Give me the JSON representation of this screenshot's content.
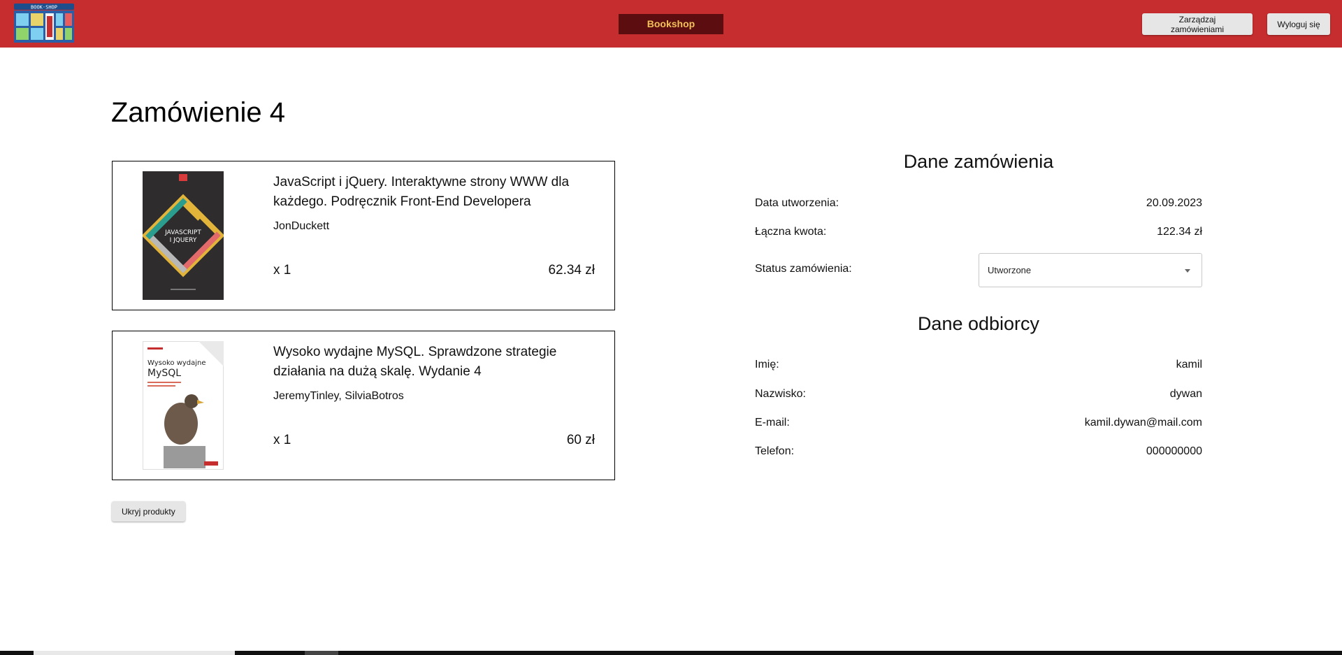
{
  "header": {
    "brand": "Bookshop",
    "logo_text": "BOOK·SHOP",
    "manage_orders_label": "Zarządzaj zamówieniami",
    "logout_label": "Wyloguj się"
  },
  "page": {
    "title": "Zamówienie 4"
  },
  "products": [
    {
      "title": "JavaScript i jQuery. Interaktywne strony WWW dla każdego. Podręcznik Front-End Developera",
      "author": "JonDuckett",
      "qty": "x 1",
      "price": "62.34 zł",
      "cover_lines": [
        "JAVASCRIPT",
        "I JQUERY"
      ]
    },
    {
      "title": "Wysoko wydajne MySQL. Sprawdzone strategie działania na dużą skalę. Wydanie 4",
      "author": "JeremyTinley, SilviaBotros",
      "qty": "x 1",
      "price": "60 zł",
      "cover_lines": [
        "Wysoko wydajne",
        "MySQL"
      ]
    }
  ],
  "hide_products_label": "Ukryj produkty",
  "order_details": {
    "title": "Dane zamówienia",
    "created_label": "Data utworzenia:",
    "created_value": "20.09.2023",
    "total_label": "Łączna kwota:",
    "total_value": "122.34 zł",
    "status_label": "Status zamówienia:",
    "status_value": "Utworzone"
  },
  "recipient": {
    "title": "Dane odbiorcy",
    "first_name_label": "Imię:",
    "first_name_value": "kamil",
    "last_name_label": "Nazwisko:",
    "last_name_value": "dywan",
    "email_label": "E-mail:",
    "email_value": "kamil.dywan@mail.com",
    "phone_label": "Telefon:",
    "phone_value": "000000000"
  },
  "colors": {
    "header_bg": "#c62d2f",
    "brand_bg": "#5c0d10",
    "brand_text": "#f2c15a",
    "button_bg": "#e6e6e6"
  }
}
